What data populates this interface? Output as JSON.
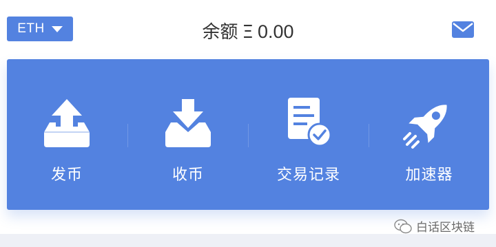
{
  "header": {
    "coin": "ETH",
    "balance_label": "余额",
    "currency_symbol": "Ξ",
    "balance_amount": "0.00"
  },
  "actions": [
    {
      "label": "发币",
      "icon": "upload-tray-icon"
    },
    {
      "label": "收币",
      "icon": "download-tray-icon"
    },
    {
      "label": "交易记录",
      "icon": "document-check-icon"
    },
    {
      "label": "加速器",
      "icon": "rocket-icon"
    }
  ],
  "watermark": {
    "text": "白话区块链",
    "icon": "wechat-icon"
  },
  "colors": {
    "accent": "#5382e0",
    "text": "#333333",
    "background": "#ffffff",
    "footer": "#eef0f6"
  }
}
